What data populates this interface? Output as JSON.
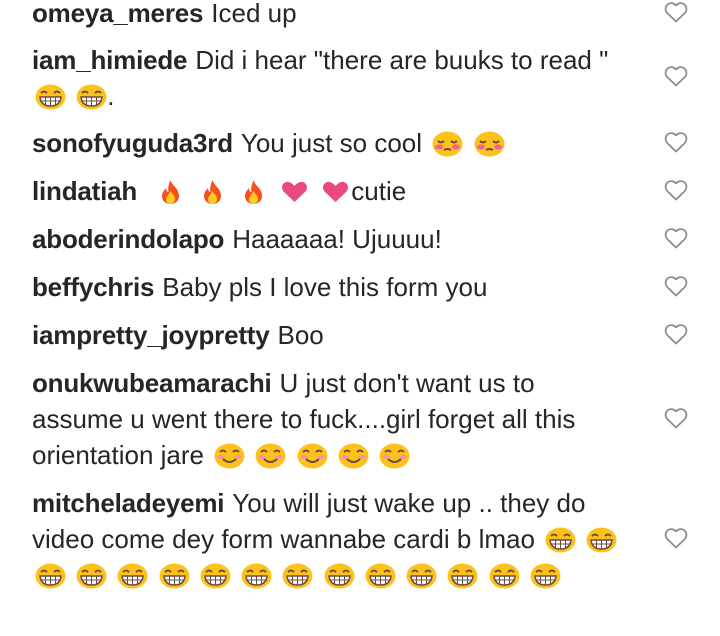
{
  "comments": [
    {
      "username": "omeya_meres",
      "text": "Iced up",
      "emojis": [],
      "suffix": ""
    },
    {
      "username": "iam_himiede",
      "text": "Did i hear \"there are buuks to read \"",
      "emojis": [
        "laughing-face",
        "laughing-face"
      ],
      "suffix": "."
    },
    {
      "username": "sonofyuguda3rd",
      "text": "You just so cool",
      "emojis": [
        "blushing-face",
        "blushing-face"
      ],
      "suffix": ""
    },
    {
      "username": "lindatiah",
      "text": "",
      "emojis": [
        "fire",
        "fire",
        "fire",
        "pink-heart",
        "pink-heart"
      ],
      "suffix": "cutie"
    },
    {
      "username": "aboderindolapo",
      "text": "Haaaaaa! Ujuuuu!",
      "emojis": [],
      "suffix": ""
    },
    {
      "username": "beffychris",
      "text": "Baby pls I love this form you",
      "emojis": [],
      "suffix": ""
    },
    {
      "username": "iampretty_joypretty",
      "text": "Boo",
      "emojis": [],
      "suffix": ""
    },
    {
      "username": "onukwubeamarachi",
      "text": "U just don't want us to assume u went there to fuck....girl forget all this orientation jare",
      "emojis": [
        "smiling-face",
        "smiling-face",
        "smiling-face",
        "smiling-face",
        "smiling-face"
      ],
      "suffix": ""
    },
    {
      "username": "mitcheladeyemi",
      "text": "You will just wake up .. they do video come dey form wannabe cardi b lmao",
      "emojis": [
        "laughing-face",
        "laughing-face",
        "laughing-face",
        "laughing-face",
        "laughing-face",
        "laughing-face",
        "laughing-face",
        "laughing-face",
        "laughing-face",
        "laughing-face",
        "laughing-face",
        "laughing-face",
        "laughing-face",
        "laughing-face",
        "laughing-face"
      ],
      "suffix": ""
    }
  ],
  "like_icon": "heart-outline-icon",
  "colors": {
    "text": "#262626",
    "heart_outline": "#8e8e8e",
    "emoji_yellow": "#fcc21b",
    "fire": "#f4511e",
    "pink_heart": "#e84a83"
  }
}
